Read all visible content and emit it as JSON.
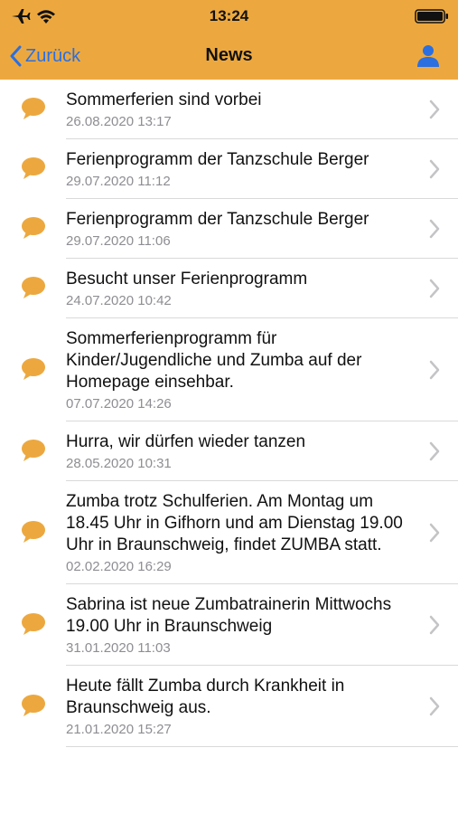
{
  "status": {
    "time": "13:24"
  },
  "nav": {
    "back_label": "Zurück",
    "title": "News"
  },
  "colors": {
    "accent": "#eca83f",
    "link": "#2b6fe0",
    "secondary_text": "#8e8e93"
  },
  "icons": {
    "status": [
      "airplane-icon",
      "wifi-icon",
      "battery-icon"
    ],
    "nav": [
      "chevron-left-icon",
      "person-icon"
    ],
    "row": [
      "speech-bubble-icon",
      "chevron-right-icon"
    ]
  },
  "news": [
    {
      "title": "Sommerferien sind vorbei",
      "date": "26.08.2020 13:17"
    },
    {
      "title": "Ferienprogramm der Tanzschule Berger",
      "date": "29.07.2020 11:12"
    },
    {
      "title": "Ferienprogramm der Tanzschule Berger",
      "date": "29.07.2020 11:06"
    },
    {
      "title": "Besucht unser Ferienprogramm",
      "date": "24.07.2020 10:42"
    },
    {
      "title": "Sommerferienprogramm für Kinder/Jugendliche und Zumba auf der Homepage einsehbar.",
      "date": "07.07.2020 14:26"
    },
    {
      "title": "Hurra, wir dürfen wieder tanzen",
      "date": "28.05.2020 10:31"
    },
    {
      "title": "Zumba trotz Schulferien. Am Montag um 18.45 Uhr in Gifhorn und am Dienstag 19.00 Uhr in Braunschweig, findet ZUMBA statt.",
      "date": "02.02.2020 16:29"
    },
    {
      "title": "Sabrina ist neue Zumbatrainerin Mittwochs 19.00 Uhr in Braunschweig",
      "date": "31.01.2020 11:03"
    },
    {
      "title": "Heute fällt Zumba durch Krankheit in Braunschweig aus.",
      "date": "21.01.2020 15:27"
    }
  ]
}
